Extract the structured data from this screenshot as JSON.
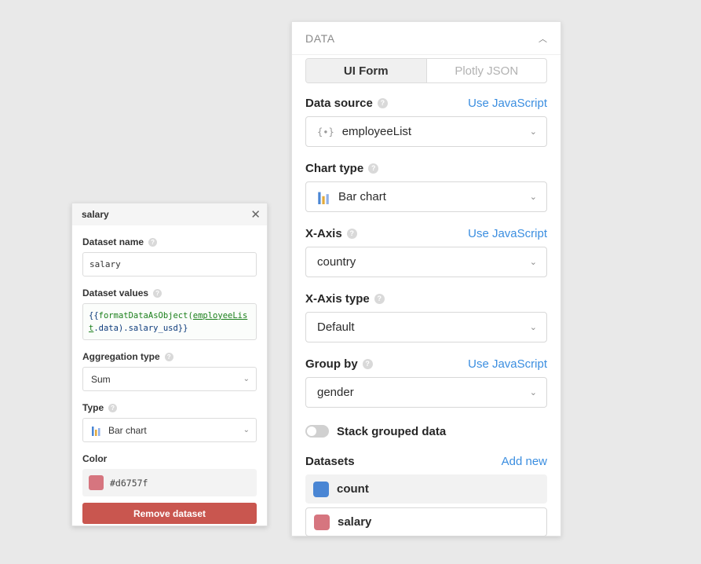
{
  "popover": {
    "title": "salary",
    "dataset_name_label": "Dataset name",
    "dataset_name_value": "salary",
    "dataset_values_label": "Dataset values",
    "dataset_values_code": {
      "open": "{{",
      "fn": "formatDataAsObject(",
      "var": "employeeList",
      "rest": ".data).salary_usd}}"
    },
    "aggregation_label": "Aggregation type",
    "aggregation_value": "Sum",
    "type_label": "Type",
    "type_value": "Bar chart",
    "color_label": "Color",
    "color_value": "#d6757f",
    "remove_label": "Remove dataset"
  },
  "panel": {
    "title": "DATA",
    "tabs": [
      {
        "label": "UI Form",
        "active": true
      },
      {
        "label": "Plotly JSON",
        "active": false
      }
    ],
    "use_js": "Use JavaScript",
    "data_source": {
      "label": "Data source",
      "value": "employeeList"
    },
    "chart_type": {
      "label": "Chart type",
      "value": "Bar chart"
    },
    "x_axis": {
      "label": "X-Axis",
      "value": "country"
    },
    "x_axis_type": {
      "label": "X-Axis type",
      "value": "Default"
    },
    "group_by": {
      "label": "Group by",
      "value": "gender"
    },
    "stack_label": "Stack grouped data",
    "datasets_label": "Datasets",
    "add_new": "Add new",
    "datasets": [
      {
        "name": "count",
        "color": "#4a86d4"
      },
      {
        "name": "salary",
        "color": "#d6757f"
      }
    ]
  },
  "colors": {
    "accent_link": "#3b8ee0",
    "remove_button": "#c9564f",
    "bar_icon": [
      "#4a86d4",
      "#e2a93b",
      "#8fb0e8"
    ]
  }
}
